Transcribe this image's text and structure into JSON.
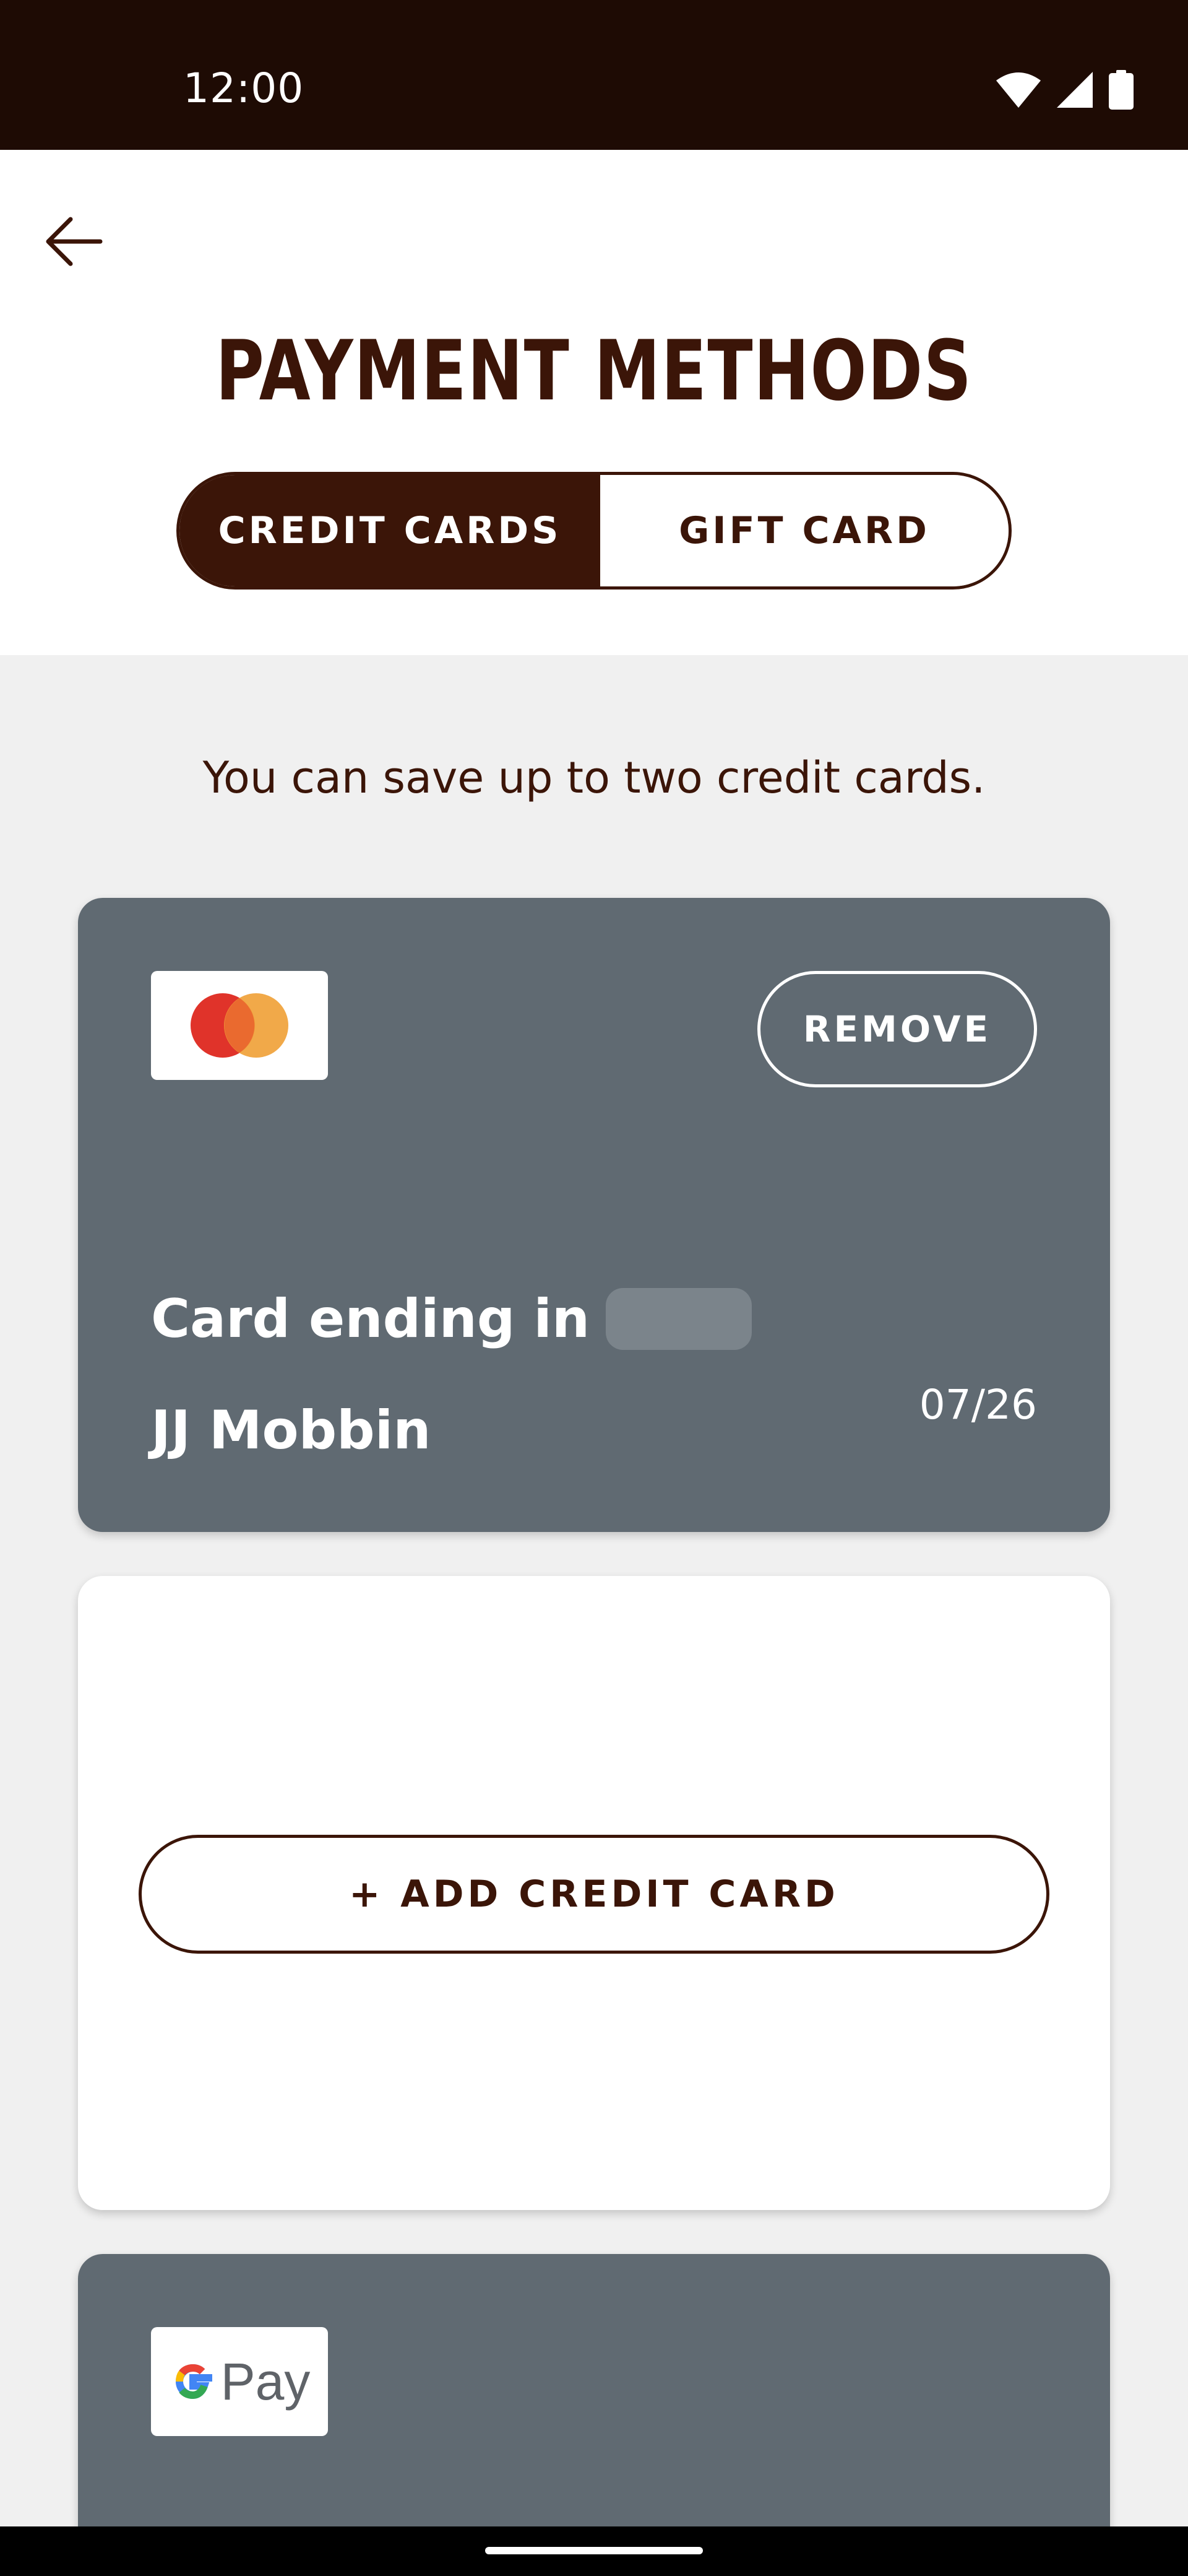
{
  "status_bar": {
    "time": "12:00",
    "icons": [
      "wifi-icon",
      "cellular-signal-icon",
      "battery-icon"
    ]
  },
  "header": {
    "back_icon": "arrow-left-icon",
    "title": "PAYMENT METHODS",
    "tabs": [
      {
        "label": "CREDIT CARDS",
        "active": true
      },
      {
        "label": "GIFT CARD",
        "active": false
      }
    ]
  },
  "info_text": "You can save up to two credit cards.",
  "saved_card": {
    "brand_icon": "mastercard-logo",
    "remove_label": "REMOVE",
    "ending_label": "Card ending in",
    "cardholder": "JJ Mobbin",
    "expiry": "07/26"
  },
  "add_card": {
    "button_label": "+ ADD CREDIT CARD"
  },
  "gpay_card": {
    "logo_g": "G",
    "logo_text": "Pay"
  },
  "colors": {
    "brand_brown": "#3b1508",
    "status_bar": "#1e0b04",
    "card_gray": "#606a72",
    "background": "#f0f0f0"
  }
}
